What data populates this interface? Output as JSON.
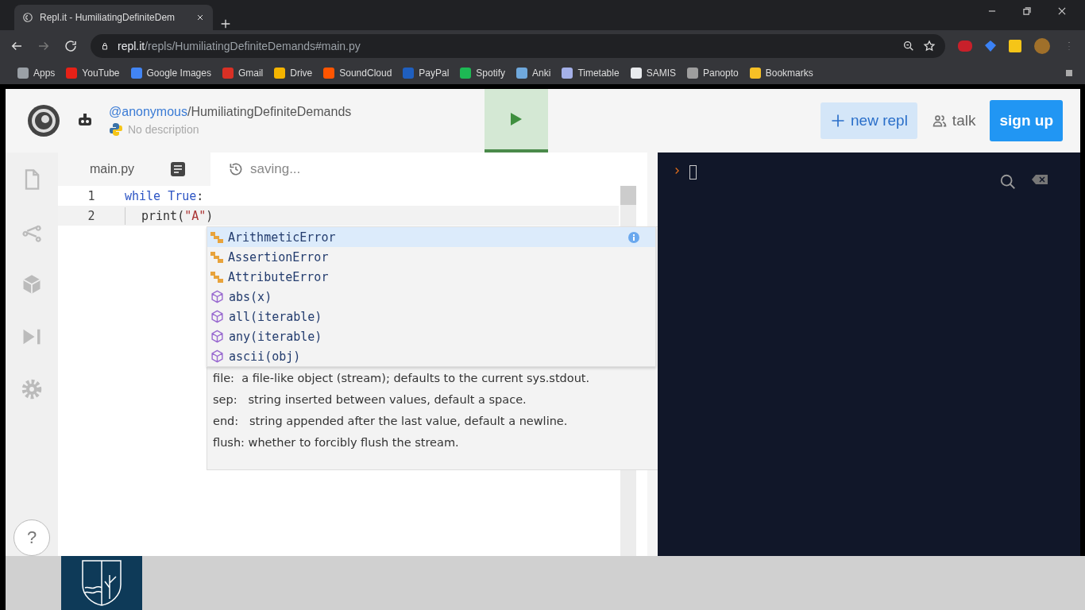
{
  "browser": {
    "tab_title": "Repl.it - HumiliatingDefiniteDem",
    "url_host": "repl.it",
    "url_path": "/repls/HumiliatingDefiniteDemands#main.py"
  },
  "bookmarks": [
    {
      "label": "Apps",
      "color": "#9aa0a6"
    },
    {
      "label": "YouTube",
      "color": "#e62117"
    },
    {
      "label": "Google Images",
      "color": "#4285f4"
    },
    {
      "label": "Gmail",
      "color": "#d93025"
    },
    {
      "label": "Drive",
      "color": "#f4b400"
    },
    {
      "label": "SoundCloud",
      "color": "#ff5500"
    },
    {
      "label": "PayPal",
      "color": "#1f5fbf"
    },
    {
      "label": "Spotify",
      "color": "#1db954"
    },
    {
      "label": "Anki",
      "color": "#6fa8dc"
    },
    {
      "label": "Timetable",
      "color": "#a4b0e8"
    },
    {
      "label": "SAMIS",
      "color": "#e8eaed"
    },
    {
      "label": "Panopto",
      "color": "#9e9e9e"
    },
    {
      "label": "Bookmarks",
      "color": "#f6c026"
    }
  ],
  "header": {
    "owner": "@anonymous",
    "repl_name": "/HumiliatingDefiniteDemands",
    "description": "No description",
    "buttons": [
      {
        "kind": "new",
        "label": "new repl"
      },
      {
        "kind": "talk",
        "label": "talk"
      },
      {
        "kind": "signup",
        "label": "sign up"
      }
    ]
  },
  "editor": {
    "file_tab": "main.py",
    "status": "saving...",
    "lines": [
      {
        "number": "1",
        "current": false,
        "tokens": [
          {
            "kind": "keyword",
            "text": "while "
          },
          {
            "kind": "constant",
            "text": "True"
          },
          {
            "kind": "plain",
            "text": ":"
          }
        ]
      },
      {
        "number": "2",
        "current": true,
        "tokens": [
          {
            "kind": "indent"
          },
          {
            "kind": "plain",
            "text": "print("
          },
          {
            "kind": "string",
            "text": "\"A\""
          },
          {
            "kind": "plain",
            "text": ")"
          }
        ]
      }
    ]
  },
  "autocomplete": [
    {
      "kind": "class",
      "label": "ArithmeticError",
      "selected": true
    },
    {
      "kind": "class",
      "label": "AssertionError",
      "selected": false
    },
    {
      "kind": "class",
      "label": "AttributeError",
      "selected": false
    },
    {
      "kind": "function",
      "label": "abs(x)",
      "selected": false
    },
    {
      "kind": "function",
      "label": "all(iterable)",
      "selected": false
    },
    {
      "kind": "function",
      "label": "any(iterable)",
      "selected": false
    },
    {
      "kind": "function",
      "label": "ascii(obj)",
      "selected": false
    }
  ],
  "docs": [
    "file:  a file-like object (stream); defaults to the current sys.stdout.",
    "sep:   string inserted between values, default a space.",
    "end:   string appended after the last value, default a newline.",
    "flush: whether to forcibly flush the stream."
  ],
  "sidebar": {
    "help": "?"
  }
}
